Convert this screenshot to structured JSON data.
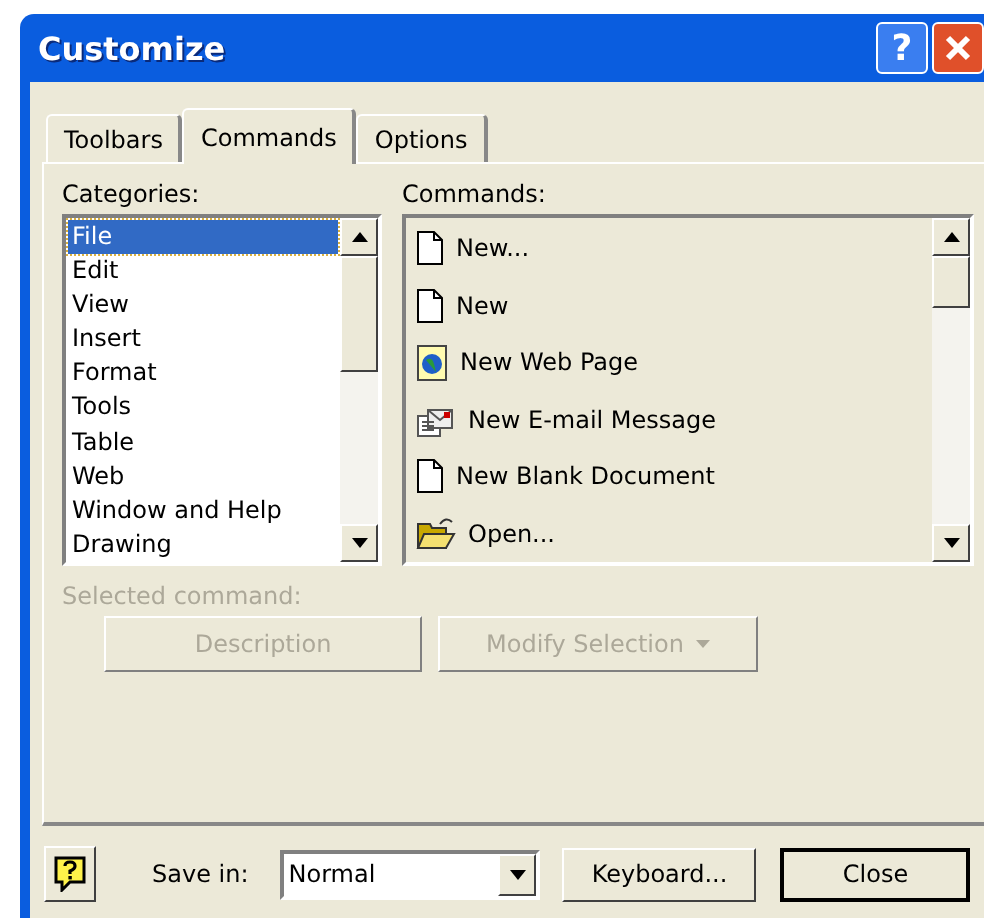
{
  "window": {
    "title": "Customize",
    "title_buttons": [
      "?"
    ]
  },
  "tabs": [
    {
      "label": "Toolbars",
      "selected": false
    },
    {
      "label": "Commands",
      "selected": true
    },
    {
      "label": "Options",
      "selected": false
    }
  ],
  "categories": {
    "label": "Categories:",
    "items": [
      {
        "label": "File",
        "selected": true
      },
      {
        "label": "Edit",
        "selected": false
      },
      {
        "label": "View",
        "selected": false
      },
      {
        "label": "Insert",
        "selected": false
      },
      {
        "label": "Format",
        "selected": false
      },
      {
        "label": "Tools",
        "selected": false
      },
      {
        "label": "Table",
        "selected": false
      },
      {
        "label": "Web",
        "selected": false
      },
      {
        "label": "Window and Help",
        "selected": false
      },
      {
        "label": "Drawing",
        "selected": false
      }
    ]
  },
  "commands": {
    "label": "Commands:",
    "items": [
      {
        "label": "New...",
        "kind": "document"
      },
      {
        "label": "New",
        "kind": "document"
      },
      {
        "label": "New Web Page",
        "kind": "webpage"
      },
      {
        "label": "New E-mail Message",
        "kind": "email"
      },
      {
        "label": "New Blank Document",
        "kind": "document"
      },
      {
        "label": "Open...",
        "kind": "folder"
      }
    ]
  },
  "selected_command": {
    "label": "Selected command:",
    "disabled": true,
    "buttons": [
      {
        "label": "Description",
        "kind": "plain"
      },
      {
        "label": "Modify Selection",
        "kind": "menu"
      }
    ]
  },
  "footer": {
    "save_in_label": "Save in:",
    "save_in_value": "Normal",
    "buttons": [
      "Keyboard...",
      "Close"
    ]
  }
}
